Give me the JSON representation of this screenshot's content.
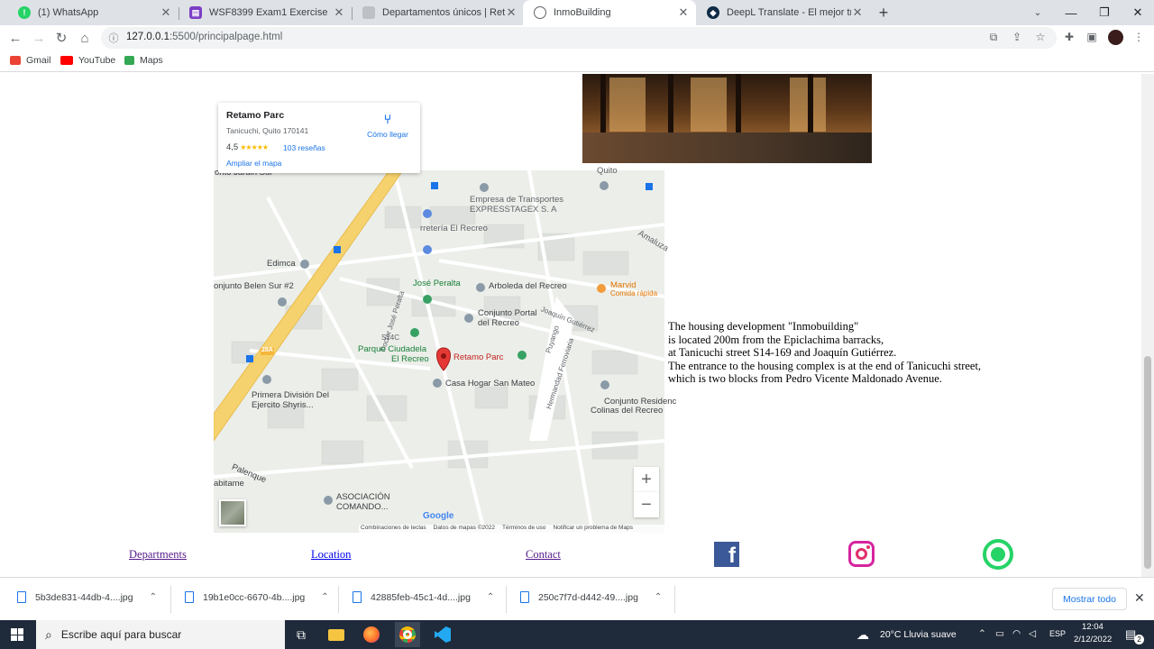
{
  "browser": {
    "tabs": [
      {
        "label": "(1) WhatsApp",
        "icon": "whatsapp-icon",
        "color": "#25d366"
      },
      {
        "label": "WSF8399 Exam1 Exercise",
        "icon": "onenote-icon",
        "color": "#7b3ec5"
      },
      {
        "label": "Departamentos únicos | Retamo",
        "icon": "page-icon",
        "color": "#9aa0a6"
      },
      {
        "label": "InmoBuilding",
        "icon": "globe-icon",
        "color": "#5f6368"
      },
      {
        "label": "DeepL Translate - El mejor tradu",
        "icon": "deepl-icon",
        "color": "#0f2b46"
      }
    ],
    "url_host": "127.0.0.1",
    "url_path": ":5500/principalpage.html",
    "bookmarks": [
      {
        "label": "Gmail",
        "color": "#ea4335"
      },
      {
        "label": "YouTube",
        "color": "#ff0000"
      },
      {
        "label": "Maps",
        "color": "#34a853"
      }
    ]
  },
  "map": {
    "place_name": "Retamo Parc",
    "place_address": "Tanicuchi, Quito 170141",
    "rating": "4,5",
    "stars": "★★★★★",
    "reviews": "103 reseñas",
    "enlarge": "Ampliar el mapa",
    "directions": "Cómo llegar",
    "labels": {
      "l1": "onto Jardin Sur",
      "l2": "Empresa de Transportes",
      "l3": "EXPRESSTAGEX S. A",
      "l4": "rretería El Recreo",
      "l5": "Quito",
      "l6": "Amaluza",
      "l7": "Edimca",
      "l8": "José Peralta",
      "l9": "Arboleda del Recreo",
      "l10": "Marvid",
      "l11": "Comida rápida",
      "l12": "onjunto Belen Sur #2",
      "l13": "Conjunto Portal",
      "l14": "del Recreo",
      "l15": "Doctor José Peralta",
      "l16": "Joaquín Gutiérrez",
      "l17": "S14C",
      "l18": "Puyango",
      "l19": "Parque Ciudadela",
      "l20": "El Recreo",
      "l21": "Retamo Parc",
      "l22": "Casa Hogar San Mateo",
      "l23": "Hermandad Ferroviaria",
      "l24": "Primera División Del",
      "l25": "Ejercito Shyris...",
      "l26": "Conjunto Residenc",
      "l27": "Colinas del Recreo",
      "l28": "Palenque",
      "l29": "abitame",
      "l30": "COMANDO...",
      "l31": "ASOCIACIÓN",
      "l32": "28A"
    },
    "google": "Google",
    "attribution": [
      "Combinaciones de teclas",
      "Datos de mapas ©2022",
      "Términos de uso",
      "Notificar un problema de Maps"
    ],
    "zoom_in": "+",
    "zoom_out": "−"
  },
  "description": {
    "line1": "The housing development \"Inmobuilding\"",
    "line2": "is located 200m from the Epiclachima barracks,",
    "line3": "at Tanicuchi street S14-169 and Joaquín Gutiérrez.",
    "line4": "The entrance to the housing complex is at the end of Tanicuchi street,",
    "line5": "which is two blocks from Pedro Vicente Maldonado Avenue."
  },
  "footer": {
    "departments": "Departments",
    "location": "Location",
    "contact": "Contact"
  },
  "downloads": [
    {
      "name": "5b3de831-44db-4....jpg"
    },
    {
      "name": "19b1e0cc-6670-4b....jpg"
    },
    {
      "name": "42885feb-45c1-4d....jpg"
    },
    {
      "name": "250c7f7d-d442-49....jpg"
    }
  ],
  "downloads_show_all": "Mostrar todo",
  "taskbar": {
    "search_placeholder": "Escribe aquí para buscar",
    "weather": "20°C  Lluvia suave",
    "lang": "ESP",
    "time": "12:04",
    "date": "2/12/2022",
    "notifications": "2"
  },
  "colors": {
    "link_visited": "#551a8b",
    "link": "#0000ee",
    "facebook": "#3b5998",
    "whatsapp": "#25d366",
    "road": "#f6d26e"
  }
}
